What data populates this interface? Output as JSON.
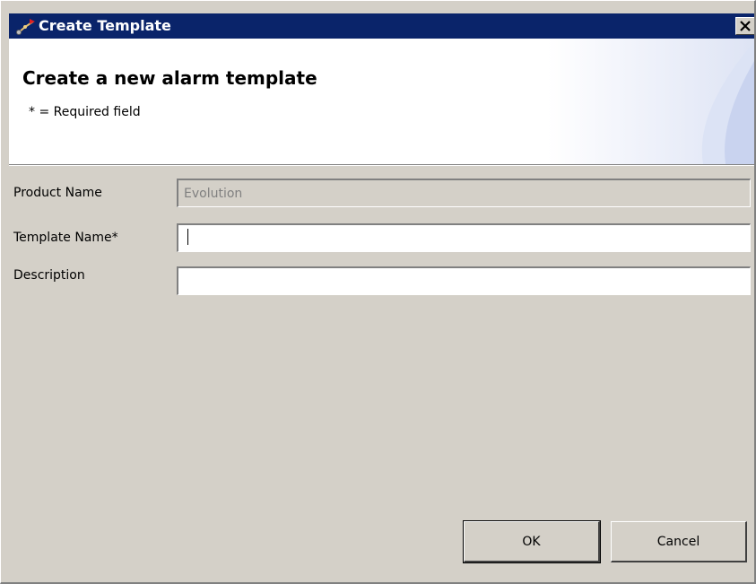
{
  "window": {
    "title": "Create Template",
    "close_glyph": "×"
  },
  "banner": {
    "title": "Create a new alarm template",
    "subtitle": "* = Required field"
  },
  "form": {
    "product_name": {
      "label": "Product Name",
      "value": "Evolution",
      "disabled": true
    },
    "template_name": {
      "label": "Template Name*",
      "value": "",
      "focused": true
    },
    "description": {
      "label": "Description",
      "value": ""
    }
  },
  "buttons": {
    "ok_label": "OK",
    "cancel_label": "Cancel"
  },
  "icons": {
    "title_icon": "alarm-template-icon",
    "close_icon": "close-icon"
  },
  "colors": {
    "titlebar": "#0a246a",
    "dialog_bg": "#d4d0c8",
    "banner_bg": "#ffffff"
  }
}
